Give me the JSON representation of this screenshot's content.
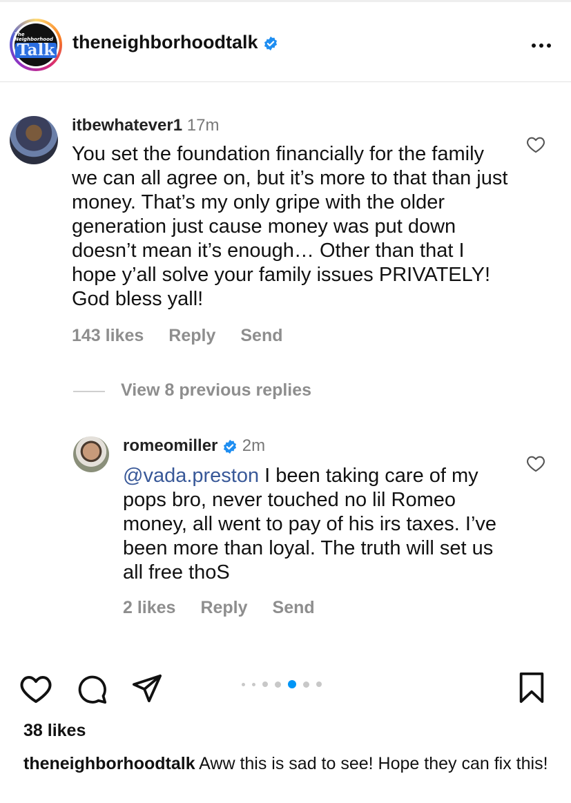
{
  "post": {
    "username": "theneighborhoodtalk",
    "avatar_text_small": "The Neighborhood",
    "avatar_text_big": "Talk"
  },
  "comments": [
    {
      "username": "itbewhatever1",
      "time": "17m",
      "text": "You set the foundation financially for the family we can all agree on, but it’s more to that than just money. That’s my only gripe with the older generation just cause money was put down doesn’t mean it’s enough… Other than that I hope y’all solve your family issues PRIVATELY! God bless yall!",
      "likes": "143 likes",
      "reply_label": "Reply",
      "send_label": "Send"
    },
    {
      "username": "romeomiller",
      "time": "2m",
      "mention": "@vada.preston",
      "text": " I been taking care of my pops bro, never touched no lil Romeo money, all went to pay of his irs taxes. I’ve been more than loyal. The truth will set us all free thoS",
      "likes": "2 likes",
      "reply_label": "Reply",
      "send_label": "Send"
    }
  ],
  "view_replies": "View 8 previous replies",
  "footer": {
    "likes": "38 likes",
    "caption_user": "theneighborhoodtalk",
    "caption_text": " Aww this is sad to see! Hope they can fix this!"
  },
  "carousel": {
    "count": 7,
    "active_index": 4
  },
  "colors": {
    "verified": "#1f8ef1",
    "mention": "#385898",
    "active_dot": "#0095f6"
  },
  "icons": [
    "verified-icon",
    "more-icon",
    "heart-icon",
    "comment-icon",
    "share-icon",
    "bookmark-icon"
  ]
}
